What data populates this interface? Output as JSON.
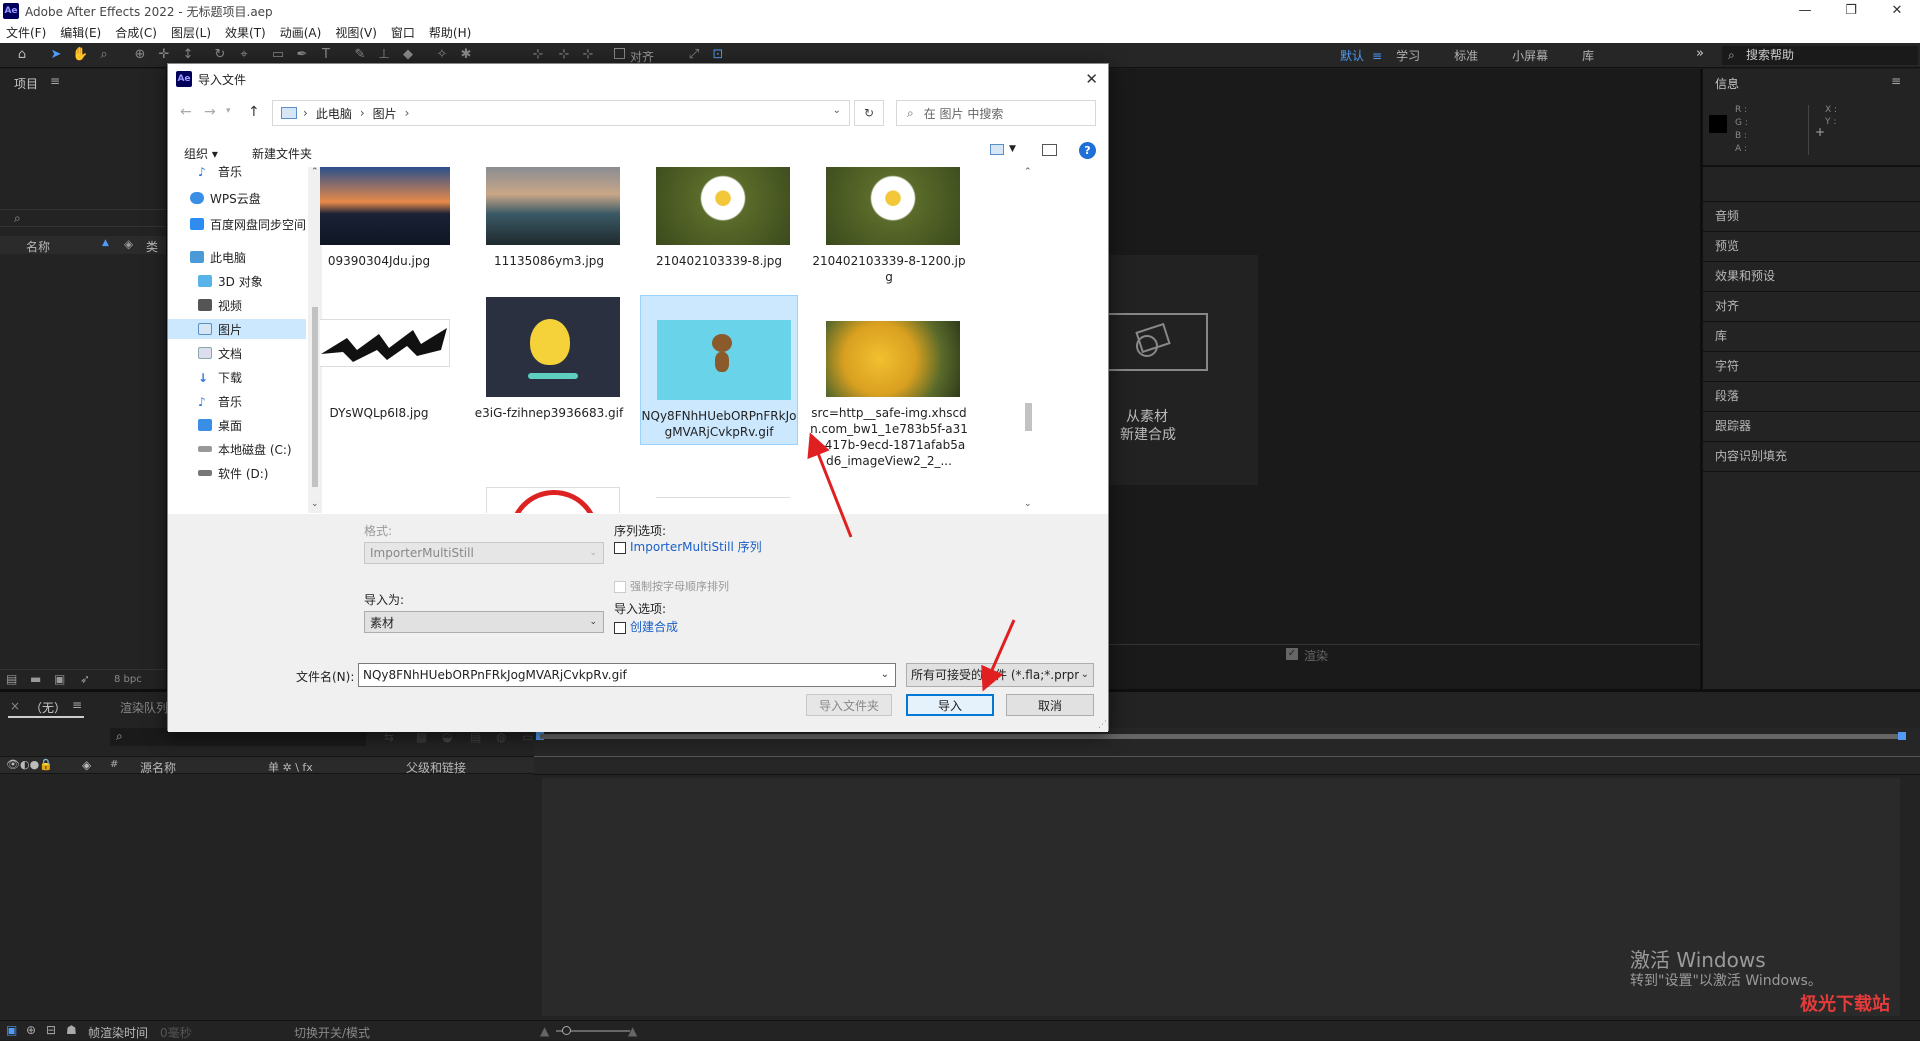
{
  "app": {
    "title": "Adobe After Effects 2022 - 无标题项目.aep",
    "logo": "Ae",
    "window_controls": [
      "—",
      "❐",
      "✕"
    ]
  },
  "menu": [
    "文件(F)",
    "编辑(E)",
    "合成(C)",
    "图层(L)",
    "效果(T)",
    "动画(A)",
    "视图(V)",
    "窗口",
    "帮助(H)"
  ],
  "toolbar": {
    "align_label": "对齐",
    "workspaces": [
      "默认",
      "学习",
      "标准",
      "小屏幕",
      "库"
    ],
    "active_workspace": "默认",
    "search_help": "搜索帮助"
  },
  "project_panel": {
    "title": "项目",
    "columns": [
      "名称",
      "类"
    ],
    "bpc": "8 bpc"
  },
  "comp_panel": {
    "new_comp_line1": "从素材",
    "new_comp_line2": "新建合成"
  },
  "render_checkbox_label": "渲染",
  "info_panel": {
    "title": "信息",
    "rgba": [
      "R :",
      "G :",
      "B :",
      "A :"
    ],
    "xy": [
      "X :",
      "Y :"
    ]
  },
  "right_panels": [
    "音频",
    "预览",
    "效果和预设",
    "对齐",
    "库",
    "字符",
    "段落",
    "跟踪器",
    "内容识别填充"
  ],
  "timeline": {
    "tab_none": "（无）",
    "tab_render": "渲染队列",
    "col_source": "源名称",
    "col_switches": "单 ✲ \\ fx",
    "col_parent": "父级和链接",
    "footer_render_time": "帧渲染时间",
    "footer_ms": "0毫秒",
    "footer_toggle": "切换开关/模式"
  },
  "watermark": {
    "line1": "激活 Windows",
    "line2": "转到\"设置\"以激活 Windows。",
    "site": "极光下载站"
  },
  "dialog": {
    "title": "导入文件",
    "breadcrumb": [
      "此电脑",
      "图片"
    ],
    "search_placeholder": "在 图片 中搜索",
    "organize": "组织 ▾",
    "new_folder": "新建文件夹",
    "nav": [
      {
        "label": "音乐",
        "icon": "music-icon",
        "color": "#2a78d8"
      },
      {
        "label": "WPS云盘",
        "icon": "cloud-icon",
        "color": "#3a8ee6"
      },
      {
        "label": "百度网盘同步空间",
        "icon": "baidu-icon",
        "color": "#2e8bef"
      },
      {
        "label": "此电脑",
        "icon": "computer-icon",
        "color": "#4a9ad8"
      },
      {
        "label": "3D 对象",
        "icon": "cube-icon",
        "color": "#58b4e8"
      },
      {
        "label": "视频",
        "icon": "video-icon",
        "color": "#555"
      },
      {
        "label": "图片",
        "icon": "pictures-icon",
        "color": "#5b8fc7"
      },
      {
        "label": "文档",
        "icon": "documents-icon",
        "color": "#8aa"
      },
      {
        "label": "下载",
        "icon": "download-icon",
        "color": "#2a78d8"
      },
      {
        "label": "音乐",
        "icon": "music-icon",
        "color": "#2a78d8"
      },
      {
        "label": "桌面",
        "icon": "desktop-icon",
        "color": "#3a8ee6"
      },
      {
        "label": "本地磁盘 (C:)",
        "icon": "drive-icon",
        "color": "#777"
      },
      {
        "label": "软件 (D:)",
        "icon": "drive-icon",
        "color": "#777"
      }
    ],
    "files": [
      {
        "name": "09390304Jdu.jpg",
        "thumb": "city-night"
      },
      {
        "name": "11135086ym3.jpg",
        "thumb": "seascape"
      },
      {
        "name": "210402103339-8.jpg",
        "thumb": "daisy"
      },
      {
        "name": "210402103339-8-1200.jpg",
        "thumb": "daisy"
      },
      {
        "name": "DYsWQLp6I8.jpg",
        "thumb": "brush-stroke"
      },
      {
        "name": "e3iG-fzihnep3936683.gif",
        "thumb": "chick"
      },
      {
        "name": "NQy8FNhHUebORPnFRkJogMVARjCvkpRv.gif",
        "thumb": "monkey",
        "selected": true
      },
      {
        "name": "src=http__safe-img.xhscdn.com_bw1_1e783b5f-a310-417b-9ecd-1871afab5ad6_imageView2_2_...",
        "thumb": "yellow-tree"
      },
      {
        "name": "",
        "thumb": "red-stamp"
      },
      {
        "name": "",
        "thumb": "blank"
      }
    ],
    "format_label": "格式:",
    "format_value": "ImporterMultiStill",
    "import_as_label": "导入为:",
    "import_as_value": "素材",
    "sequence_options_label": "序列选项:",
    "sequence_checkbox": "ImporterMultiStill 序列",
    "force_alpha_checkbox": "强制按字母顺序排列",
    "import_options_label": "导入选项:",
    "create_comp_checkbox": "创建合成",
    "filename_label": "文件名(N):",
    "filename_value": "NQy8FNhHUebORPnFRkJogMVARjCvkpRv.gif",
    "filetype_value": "所有可接受的文件 (*.fla;*.prpr",
    "import_folder_btn": "导入文件夹",
    "import_btn": "导入",
    "cancel_btn": "取消"
  },
  "colors": {
    "accent": "#4f9bf5",
    "arrow": "#e02020",
    "selection": "#cce8ff"
  }
}
